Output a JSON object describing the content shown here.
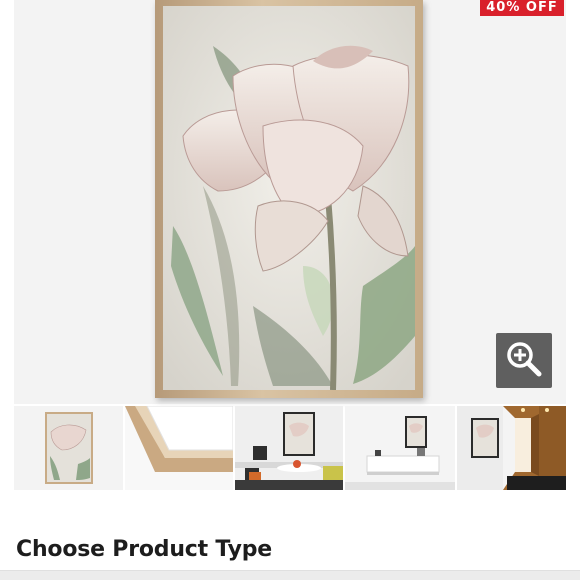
{
  "product": {
    "sale_badge": "40% OFF",
    "main_image": "framed-tulip-canvas-print"
  },
  "zoom_button": {
    "icon": "magnifier-plus-icon"
  },
  "thumbnails": [
    {
      "name": "thumb-product-front",
      "depicts": "framed-tulip-artwork"
    },
    {
      "name": "thumb-frame-corner",
      "depicts": "frame-corner-detail"
    },
    {
      "name": "thumb-kitchen",
      "depicts": "artwork-in-dining-room"
    },
    {
      "name": "thumb-living-room",
      "depicts": "artwork-over-sideboard"
    },
    {
      "name": "thumb-hallway",
      "depicts": "artwork-in-hallway"
    }
  ],
  "section": {
    "title": "Choose Product Type"
  },
  "colors": {
    "badge": "#d9202b",
    "zoom_bg": "#5f5f5f",
    "hero_bg": "#f3f3f3"
  }
}
